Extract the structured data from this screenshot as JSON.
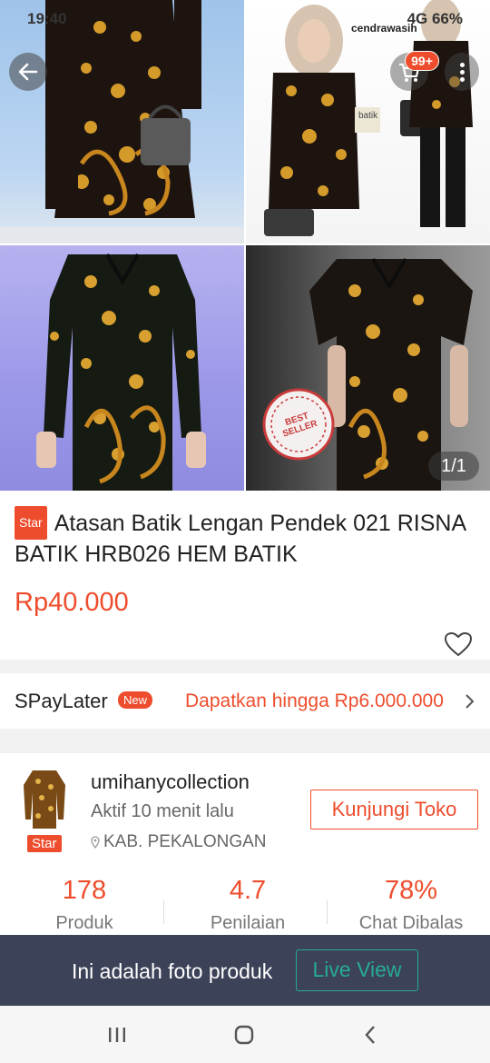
{
  "status_bar": {
    "time": "19:40",
    "right": "4G 66%"
  },
  "icons": {
    "back": "arrow-left-icon",
    "cart": "shopping-cart-icon",
    "more": "more-vertical-icon",
    "favorite": "heart-icon",
    "chevron": "chevron-right-icon",
    "location": "location-pin-icon"
  },
  "cart_badge": "99+",
  "gallery": {
    "counter": "1/1",
    "overlay_brand": "cendrawasih",
    "overlay_tag": "batik",
    "stamp_text": "BEST SELLER"
  },
  "product": {
    "badge": "Star",
    "title": "Atasan Batik Lengan Pendek 021 RISNA BATIK HRB026 HEM BATIK",
    "price": "Rp40.000"
  },
  "spaylater": {
    "label": "SPayLater",
    "new_badge": "New",
    "offer": "Dapatkan hingga Rp6.000.000"
  },
  "shop": {
    "name": "umihanycollection",
    "badge": "Star",
    "active": "Aktif 10 menit lalu",
    "location": "KAB. PEKALONGAN",
    "visit_button": "Kunjungi Toko",
    "stats": [
      {
        "value": "178",
        "label": "Produk"
      },
      {
        "value": "4.7",
        "label": "Penilaian"
      },
      {
        "value": "78%",
        "label": "Chat Dibalas"
      }
    ]
  },
  "banner": {
    "text": "Ini adalah foto produk",
    "button": "Live View"
  },
  "colors": {
    "accent": "#ee4d2d",
    "live_view": "#26aa99",
    "banner_bg": "#3c4258"
  }
}
